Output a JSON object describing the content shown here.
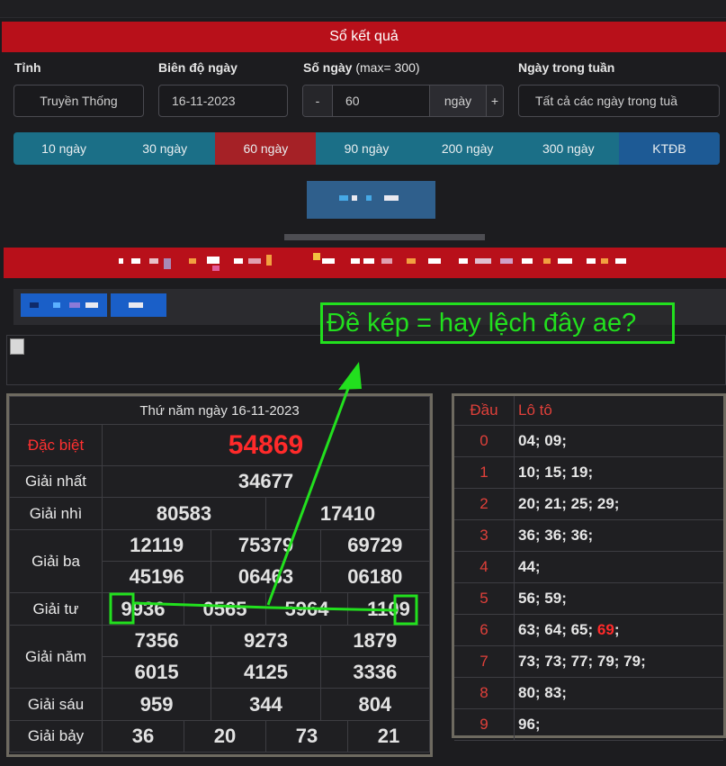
{
  "header": {
    "title": "Sổ kết quả"
  },
  "filters": {
    "province_label": "Tỉnh",
    "province_value": "Truyền Thống",
    "date_label": "Biên độ ngày",
    "date_value": "16-11-2023",
    "days_label": "Số ngày",
    "days_sub": "(max= 300)",
    "minus": "-",
    "days_value": "60",
    "days_unit": "ngày",
    "plus": "+",
    "weekday_label": "Ngày trong tuần",
    "weekday_value": "Tất cả các ngày trong tuầ"
  },
  "tabs": [
    {
      "label": "10 ngày"
    },
    {
      "label": "30 ngày"
    },
    {
      "label": "60 ngày"
    },
    {
      "label": "90 ngày"
    },
    {
      "label": "200 ngày"
    },
    {
      "label": "300 ngày"
    },
    {
      "label": "KTĐB"
    }
  ],
  "annotation": {
    "text": "Đề kép = hay lệch đây ae?"
  },
  "results": {
    "date": "Thứ năm ngày 16-11-2023",
    "special_label": "Đặc biệt",
    "special": "54869",
    "first_label": "Giải nhất",
    "first": "34677",
    "second_label": "Giải nhì",
    "second": [
      "80583",
      "17410"
    ],
    "third_label": "Giải ba",
    "third": [
      "12119",
      "75379",
      "69729",
      "45196",
      "06463",
      "06180"
    ],
    "fourth_label": "Giải tư",
    "fourth": [
      "9936",
      "0565",
      "5964",
      "1109"
    ],
    "fifth_label": "Giải năm",
    "fifth": [
      "7356",
      "9273",
      "1879",
      "6015",
      "4125",
      "3336"
    ],
    "sixth_label": "Giải sáu",
    "sixth": [
      "959",
      "344",
      "804"
    ],
    "seventh_label": "Giải bảy",
    "seventh": [
      "36",
      "20",
      "73",
      "21"
    ]
  },
  "loto": {
    "head_label": "Đầu",
    "loto_label": "Lô tô",
    "rows": [
      {
        "head": "0",
        "values": "04; 09;"
      },
      {
        "head": "1",
        "values": "10; 15; 19;"
      },
      {
        "head": "2",
        "values": "20; 21; 25; 29;"
      },
      {
        "head": "3",
        "values": "36; 36; 36;"
      },
      {
        "head": "4",
        "values": "44;"
      },
      {
        "head": "5",
        "values": "56; 59;"
      },
      {
        "head": "6",
        "values": "63; 64; 65;",
        "special": "69",
        "tail": ";"
      },
      {
        "head": "7",
        "values": "73; 73; 77; 79; 79;"
      },
      {
        "head": "8",
        "values": "80; 83;"
      },
      {
        "head": "9",
        "values": "96;"
      }
    ]
  },
  "colors": {
    "accent_red": "#b8101a",
    "tab_blue": "#1b6f87",
    "annotation_green": "#22e01e",
    "special_red": "#ff2a2a"
  }
}
